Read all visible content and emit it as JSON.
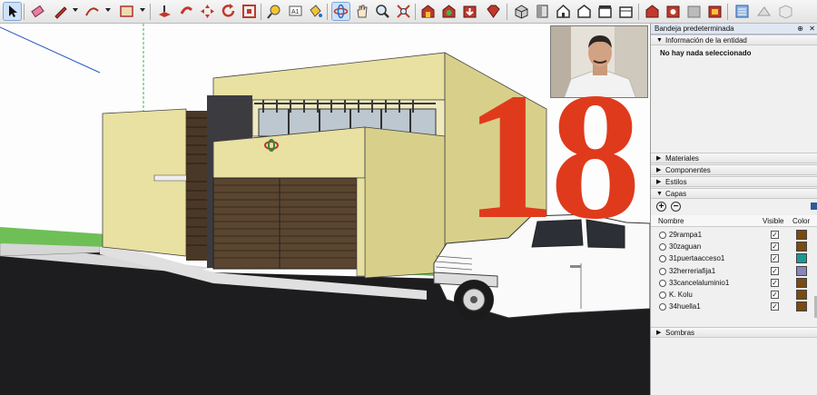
{
  "toolbar": {
    "icons": [
      "select-tool-icon",
      "eraser-icon",
      "pencil-icon",
      "line-dropdown-icon",
      "arc-icon",
      "arc-dropdown-icon",
      "rectangle-icon",
      "rectangle-dropdown-icon",
      "push-pull-icon",
      "follow-me-icon",
      "move-icon",
      "rotate-icon",
      "offset-icon",
      "tape-measure-icon",
      "text-icon",
      "paint-bucket-icon",
      "orbit-icon",
      "pan-icon",
      "zoom-icon",
      "zoom-extents-icon",
      "warehouse-icon",
      "share-model-icon",
      "get-models-icon",
      "ruby-icon",
      "iso-view-icon",
      "top-view-icon",
      "front-view-icon",
      "right-view-icon",
      "back-view-icon",
      "left-view-icon",
      "warehouse2-icon",
      "components-icon",
      "share-icon",
      "extension-icon",
      "layers-icon",
      "shadows-icon",
      "styles-icon"
    ]
  },
  "overlay": {
    "episode_number": "18",
    "episode_color": "#e03a1c"
  },
  "tray": {
    "title": "Bandeja predeterminada",
    "pin_glyph": "⊕",
    "close_glyph": "✕",
    "entity_info": {
      "header": "Información de la entidad",
      "message": "No hay nada seleccionado"
    },
    "panels": {
      "materials": "Materiales",
      "components": "Componentes",
      "styles": "Estilos",
      "layers": "Capas",
      "shadows": "Sombras"
    },
    "layers": {
      "add_glyph": "+",
      "remove_glyph": "−",
      "col_name": "Nombre",
      "col_visible": "Visible",
      "col_color": "Color",
      "rows": [
        {
          "name": "29rampa1",
          "visible": true,
          "color": "#7a4a10"
        },
        {
          "name": "30zaguan",
          "visible": true,
          "color": "#7a4a10"
        },
        {
          "name": "31puertaacceso1",
          "visible": true,
          "color": "#1a9a95"
        },
        {
          "name": "32herreriafija1",
          "visible": true,
          "color": "#8a86b8"
        },
        {
          "name": "33cancelaluminio1",
          "visible": true,
          "color": "#7a4a10"
        },
        {
          "name": "K. Kolu",
          "visible": true,
          "color": "#7a4a10"
        },
        {
          "name": "34huella1",
          "visible": true,
          "color": "#7a4a10"
        }
      ]
    }
  }
}
